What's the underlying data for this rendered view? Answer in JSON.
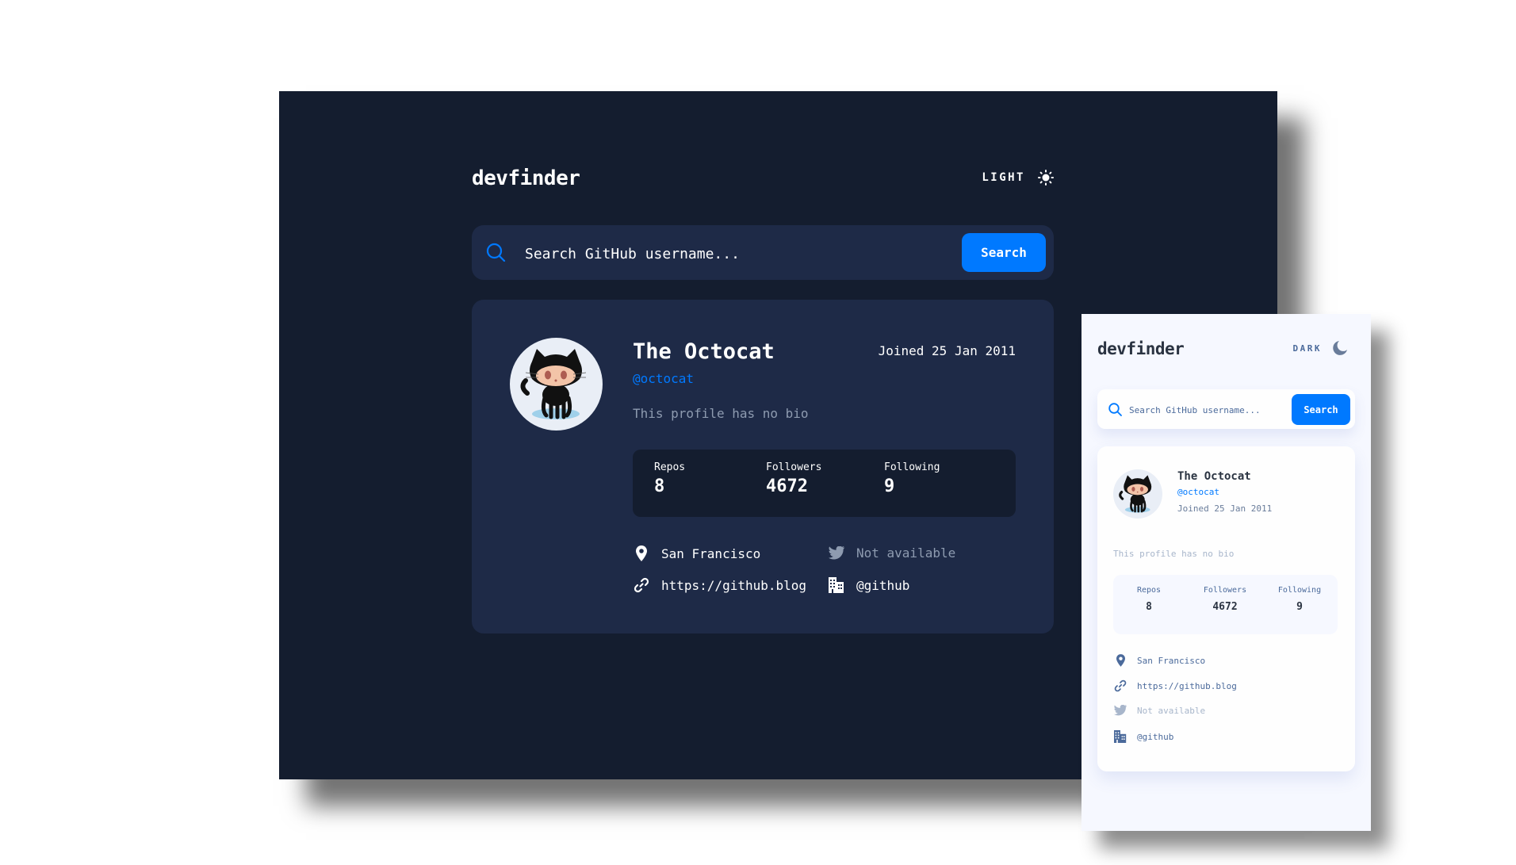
{
  "colors": {
    "accent": "#0079ff",
    "dark_bg": "#141d2f",
    "dark_card": "#1e2a47",
    "light_bg": "#f6f8ff",
    "light_card": "#fefefe",
    "muted": "#8e9bb0"
  },
  "desktop_dark": {
    "logo": "devfinder",
    "theme_toggle": {
      "label": "LIGHT",
      "icon": "sun-icon"
    },
    "search": {
      "placeholder": "Search GitHub username...",
      "value": "",
      "button_label": "Search",
      "icon": "search-icon"
    },
    "profile": {
      "name": "The Octocat",
      "login": "@octocat",
      "joined": "Joined 25 Jan 2011",
      "bio": "This profile has no bio",
      "stats": [
        {
          "label": "Repos",
          "value": "8"
        },
        {
          "label": "Followers",
          "value": "4672"
        },
        {
          "label": "Following",
          "value": "9"
        }
      ],
      "links": {
        "location": {
          "icon": "location-pin-icon",
          "text": "San Francisco"
        },
        "twitter": {
          "icon": "twitter-icon",
          "text": "Not available"
        },
        "website": {
          "icon": "link-icon",
          "text": "https://github.blog"
        },
        "company": {
          "icon": "building-icon",
          "text": "@github"
        }
      }
    }
  },
  "mobile_light": {
    "logo": "devfinder",
    "theme_toggle": {
      "label": "DARK",
      "icon": "moon-icon"
    },
    "search": {
      "placeholder": "Search GitHub username...",
      "value": "",
      "button_label": "Search",
      "icon": "search-icon"
    },
    "profile": {
      "name": "The Octocat",
      "login": "@octocat",
      "joined": "Joined 25 Jan 2011",
      "bio": "This profile has no bio",
      "stats": [
        {
          "label": "Repos",
          "value": "8"
        },
        {
          "label": "Followers",
          "value": "4672"
        },
        {
          "label": "Following",
          "value": "9"
        }
      ],
      "links": {
        "location": {
          "icon": "location-pin-icon",
          "text": "San Francisco"
        },
        "website": {
          "icon": "link-icon",
          "text": "https://github.blog"
        },
        "twitter": {
          "icon": "twitter-icon",
          "text": "Not available"
        },
        "company": {
          "icon": "building-icon",
          "text": "@github"
        }
      }
    }
  }
}
